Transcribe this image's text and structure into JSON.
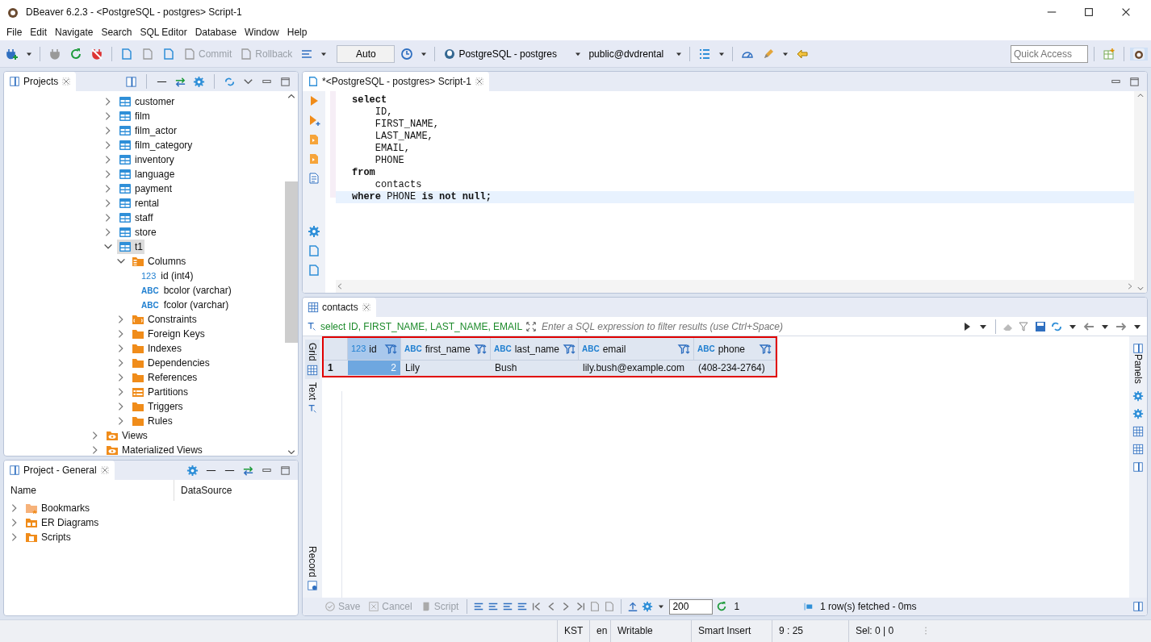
{
  "window": {
    "title": "DBeaver 6.2.3 - <PostgreSQL - postgres> Script-1"
  },
  "menu": [
    "File",
    "Edit",
    "Navigate",
    "Search",
    "SQL Editor",
    "Database",
    "Window",
    "Help"
  ],
  "toolbar": {
    "commit": {
      "label": "Commit",
      "disabled": true
    },
    "rollback": {
      "label": "Rollback",
      "disabled": true
    },
    "mode": "Auto",
    "connection": "PostgreSQL - postgres",
    "schema": "public@dvdrental",
    "quick_access": {
      "placeholder": "Quick Access"
    }
  },
  "projects": {
    "tab": "Projects",
    "tree": [
      {
        "children": [
          {
            "name": "customer",
            "kind": "table",
            "expanded": false,
            "selected": false
          },
          {
            "name": "film",
            "kind": "table",
            "expanded": false,
            "selected": false
          },
          {
            "name": "film_actor",
            "kind": "table",
            "expanded": false,
            "selected": false
          },
          {
            "name": "film_category",
            "kind": "table",
            "expanded": false,
            "selected": false
          },
          {
            "name": "inventory",
            "kind": "table",
            "expanded": false,
            "selected": false
          },
          {
            "name": "language",
            "kind": "table",
            "expanded": false,
            "selected": false
          },
          {
            "name": "payment",
            "kind": "table",
            "expanded": false,
            "selected": false
          },
          {
            "name": "rental",
            "kind": "table",
            "expanded": false,
            "selected": false
          },
          {
            "name": "staff",
            "kind": "table",
            "expanded": false,
            "selected": false
          },
          {
            "name": "store",
            "kind": "table",
            "expanded": false,
            "selected": false
          },
          {
            "name": "t1",
            "kind": "table",
            "expanded": true,
            "selected": true,
            "children": [
              {
                "name": "Columns",
                "kind": "columns",
                "expanded": true,
                "selected": false,
                "children": [
                  {
                    "name": "id (int4)",
                    "kind": "column",
                    "type_badge": "123",
                    "selected": false
                  },
                  {
                    "name": "bcolor (varchar)",
                    "kind": "column",
                    "type_badge": "ABC",
                    "selected": false
                  },
                  {
                    "name": "fcolor (varchar)",
                    "kind": "column",
                    "type_badge": "ABC",
                    "selected": false
                  }
                ]
              },
              {
                "name": "Constraints",
                "kind": "constraints",
                "expanded": false,
                "selected": false
              },
              {
                "name": "Foreign Keys",
                "kind": "folder",
                "expanded": false,
                "selected": false
              },
              {
                "name": "Indexes",
                "kind": "folder",
                "expanded": false,
                "selected": false
              },
              {
                "name": "Dependencies",
                "kind": "folder",
                "expanded": false,
                "selected": false
              },
              {
                "name": "References",
                "kind": "folder",
                "expanded": false,
                "selected": false
              },
              {
                "name": "Partitions",
                "kind": "partitions",
                "expanded": false,
                "selected": false
              },
              {
                "name": "Triggers",
                "kind": "folder",
                "expanded": false,
                "selected": false
              },
              {
                "name": "Rules",
                "kind": "folder",
                "expanded": false,
                "selected": false
              }
            ]
          }
        ]
      },
      {
        "name": "Views",
        "kind": "view",
        "expanded": false,
        "selected": false
      },
      {
        "name": "Materialized Views",
        "kind": "view",
        "expanded": false,
        "selected": false
      }
    ]
  },
  "project_general": {
    "tab": "Project - General",
    "columns": [
      "Name",
      "DataSource"
    ],
    "items": [
      {
        "name": "Bookmarks",
        "kind": "bookmarks",
        "expanded": false
      },
      {
        "name": "ER Diagrams",
        "kind": "diagrams",
        "expanded": false
      },
      {
        "name": "Scripts",
        "kind": "scripts",
        "expanded": false
      }
    ]
  },
  "editor": {
    "tab": "*<PostgreSQL - postgres> Script-1",
    "lines": [
      {
        "text": "**select**",
        "highlighted": false
      },
      {
        "text": "    ID,",
        "highlighted": false
      },
      {
        "text": "    FIRST_NAME,",
        "highlighted": false
      },
      {
        "text": "    LAST_NAME,",
        "highlighted": false
      },
      {
        "text": "    EMAIL,",
        "highlighted": false
      },
      {
        "text": "    PHONE",
        "highlighted": false
      },
      {
        "text": "**from**",
        "highlighted": false
      },
      {
        "text": "    contacts",
        "highlighted": false
      },
      {
        "text": "**where** PHONE **is not null;**",
        "highlighted": true
      }
    ]
  },
  "results": {
    "tab": "contacts",
    "filter_query": "select ID, FIRST_NAME, LAST_NAME, EMAIL",
    "filter": {
      "placeholder": "Enter a SQL expression to filter results (use Ctrl+Space)"
    },
    "side_tabs": [
      {
        "label": "Grid",
        "selected": true
      },
      {
        "label": "Text",
        "selected": false
      },
      {
        "label": "Record",
        "selected": false
      }
    ],
    "panels_label": "Panels",
    "grid": {
      "highlighted": true,
      "columns": [
        {
          "name": "id",
          "type_badge": "123"
        },
        {
          "name": "first_name",
          "type_badge": "ABC"
        },
        {
          "name": "last_name",
          "type_badge": "ABC"
        },
        {
          "name": "email",
          "type_badge": "ABC"
        },
        {
          "name": "phone",
          "type_badge": "ABC"
        }
      ],
      "rows": [
        {
          "number": "1",
          "cells": [
            {
              "text": "2",
              "selected": true
            },
            {
              "text": "Lily",
              "selected": false
            },
            {
              "text": "Bush",
              "selected": false
            },
            {
              "text": "lily.bush@example.com",
              "selected": false
            },
            {
              "text": "(408-234-2764)",
              "selected": false
            }
          ]
        }
      ]
    },
    "bottom": {
      "save": {
        "label": "Save",
        "disabled": true
      },
      "cancel": {
        "label": "Cancel",
        "disabled": true
      },
      "script": {
        "label": "Script",
        "disabled": true
      },
      "fetch_size": "200",
      "row_count": "1",
      "status": "1 row(s) fetched - 0ms"
    }
  },
  "status_bar": [
    "KST",
    "en",
    "Writable",
    "Smart Insert",
    "9 : 25",
    "Sel: 0 | 0"
  ]
}
